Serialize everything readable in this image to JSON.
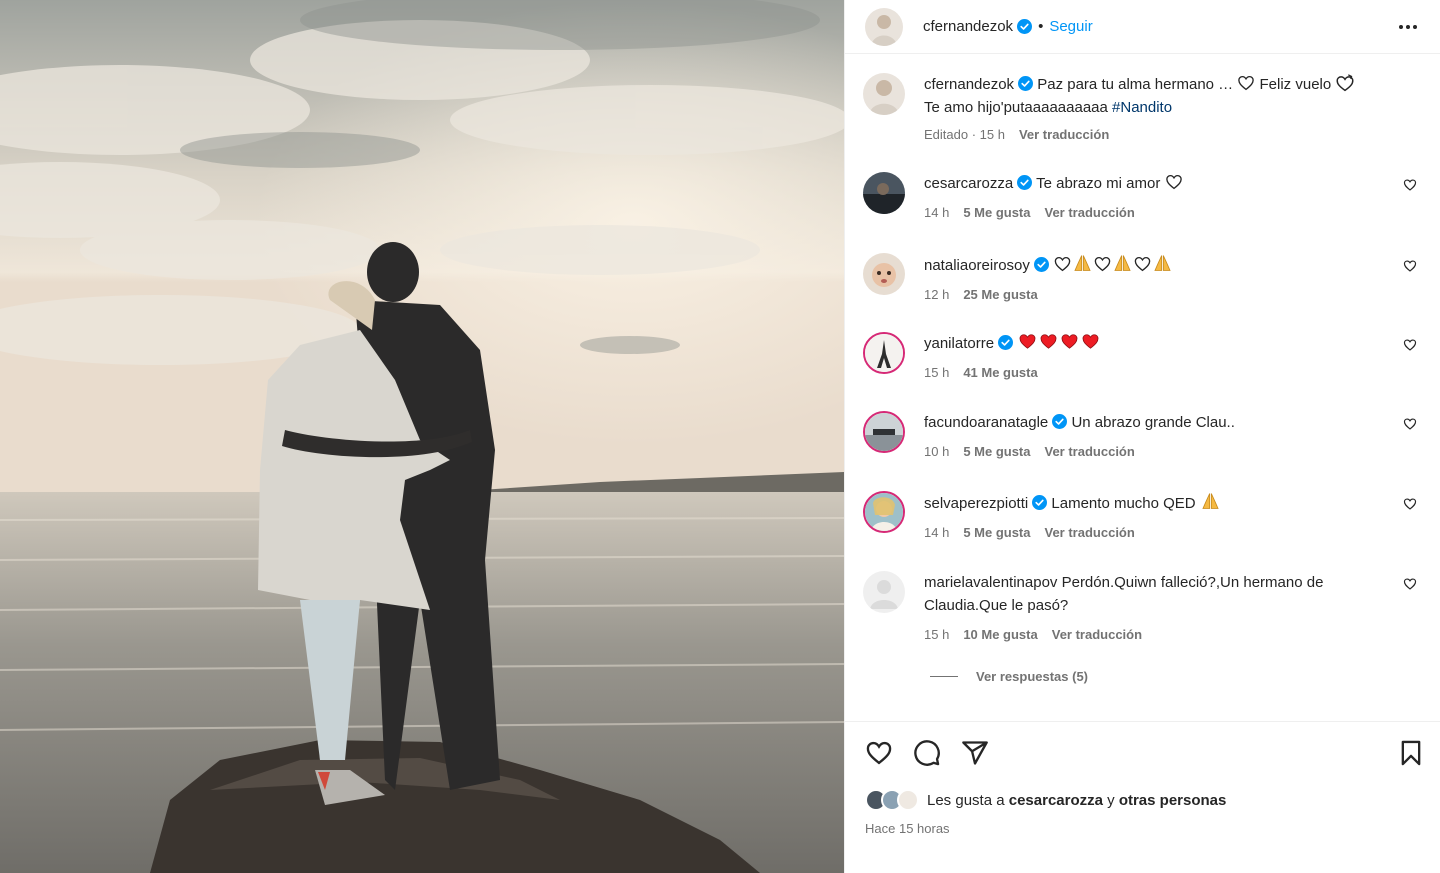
{
  "header": {
    "username": "cfernandezok",
    "separator": "•",
    "follow_label": "Seguir",
    "more_icon": "more-horizontal-icon"
  },
  "caption": {
    "username": "cfernandezok",
    "text_line1": "Paz para tu alma hermano … ",
    "text_heart_after": " Feliz vuelo ",
    "text_line2": "Te amo hijo'putaaaaaaaaaa ",
    "hashtag": "#Nandito",
    "edited_time": "Editado · 15 h",
    "translate": "Ver traducción"
  },
  "comments": [
    {
      "username": "cesarcarozza",
      "text": "Te abrazo mi amor",
      "time": "14 h",
      "likes": "5 Me gusta",
      "translate": "Ver traducción"
    },
    {
      "username": "nataliaoreirosoy",
      "text": "",
      "time": "12 h",
      "likes": "25 Me gusta",
      "translate": ""
    },
    {
      "username": "yanilatorre",
      "text": "",
      "time": "15 h",
      "likes": "41 Me gusta",
      "translate": ""
    },
    {
      "username": "facundoaranatagle",
      "text": "Un abrazo grande Clau..",
      "time": "10 h",
      "likes": "5 Me gusta",
      "translate": "Ver traducción"
    },
    {
      "username": "selvaperezpiotti",
      "text": "Lamento mucho QED",
      "time": "14 h",
      "likes": "5 Me gusta",
      "translate": "Ver traducción"
    },
    {
      "username": "marielavalentinapov",
      "text": "Perdón.Quiwn falleció?,Un hermano de Claudia.Que le pasó?",
      "time": "15 h",
      "likes": "10 Me gusta",
      "translate": "Ver traducción"
    }
  ],
  "view_replies": "Ver respuestas (5)",
  "footer": {
    "likes_prefix": "Les gusta a",
    "likes_user": "cesarcarozza",
    "likes_joiner": "y",
    "likes_suffix": "otras personas",
    "time_ago": "Hace 15 horas"
  },
  "colors": {
    "accent": "#0095f6",
    "verified": "#0095f6",
    "heart_red": "#ed1c24",
    "muted": "#737373"
  }
}
